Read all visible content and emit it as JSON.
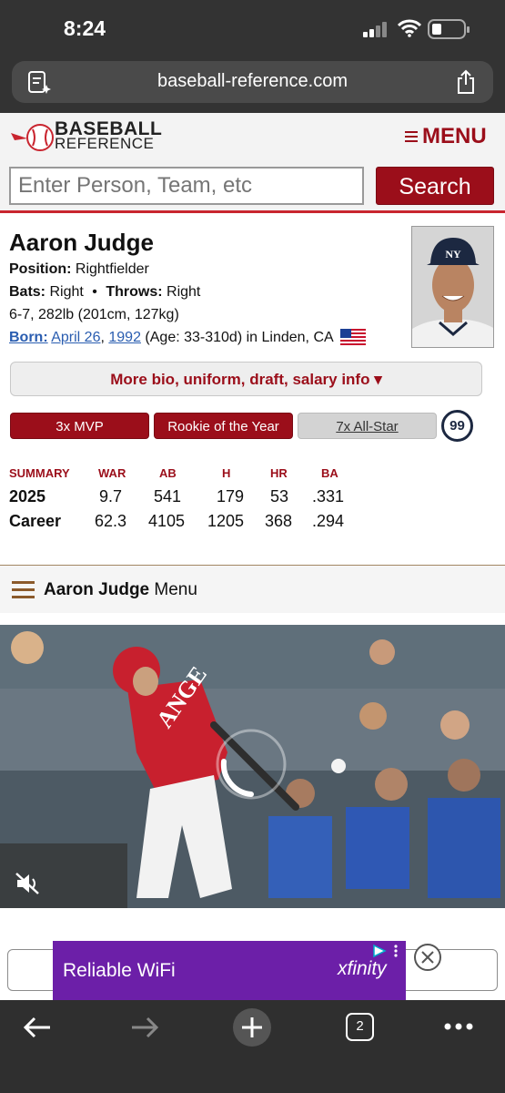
{
  "status_bar": {
    "time": "8:24"
  },
  "browser": {
    "url": "baseball-reference.com",
    "tab_count": "2"
  },
  "site": {
    "logo_line1": "BASEBALL",
    "logo_line2": "REFERENCE",
    "menu_label": "MENU",
    "search_placeholder": "Enter Person, Team, etc",
    "search_button": "Search",
    "brand_color": "#9b0e1a"
  },
  "player": {
    "name": "Aaron Judge",
    "position_label": "Position:",
    "position": "Rightfielder",
    "bats_label": "Bats:",
    "bats": "Right",
    "separator": "•",
    "throws_label": "Throws:",
    "throws": "Right",
    "size": "6-7, 282lb (201cm, 127kg)",
    "born_label": "Born:",
    "born_date": "April 26",
    "born_comma": ",",
    "born_year": "1992",
    "born_rest": "(Age: 33-310d) in Linden, CA",
    "more_bio": "More bio, uniform, draft, salary info ▾",
    "awards": [
      "3x MVP",
      "Rookie of the Year",
      "7x All-Star"
    ],
    "jersey_number": "99"
  },
  "summary": {
    "headers": [
      "SUMMARY",
      "WAR",
      "AB",
      "H",
      "HR",
      "BA"
    ],
    "rows": [
      [
        "2025",
        "9.7",
        "541",
        "179",
        "53",
        ".331"
      ],
      [
        "Career",
        "62.3",
        "4105",
        "1205",
        "368",
        ".294"
      ]
    ]
  },
  "player_menu": {
    "name": "Aaron Judge",
    "suffix": "Menu"
  },
  "video": {
    "mute_icon": "muted-speaker-icon",
    "loading": "spinner-icon"
  },
  "ad": {
    "text": "Reliable WiFi",
    "brand": "xfinity",
    "accent": "#6c1fa8"
  }
}
